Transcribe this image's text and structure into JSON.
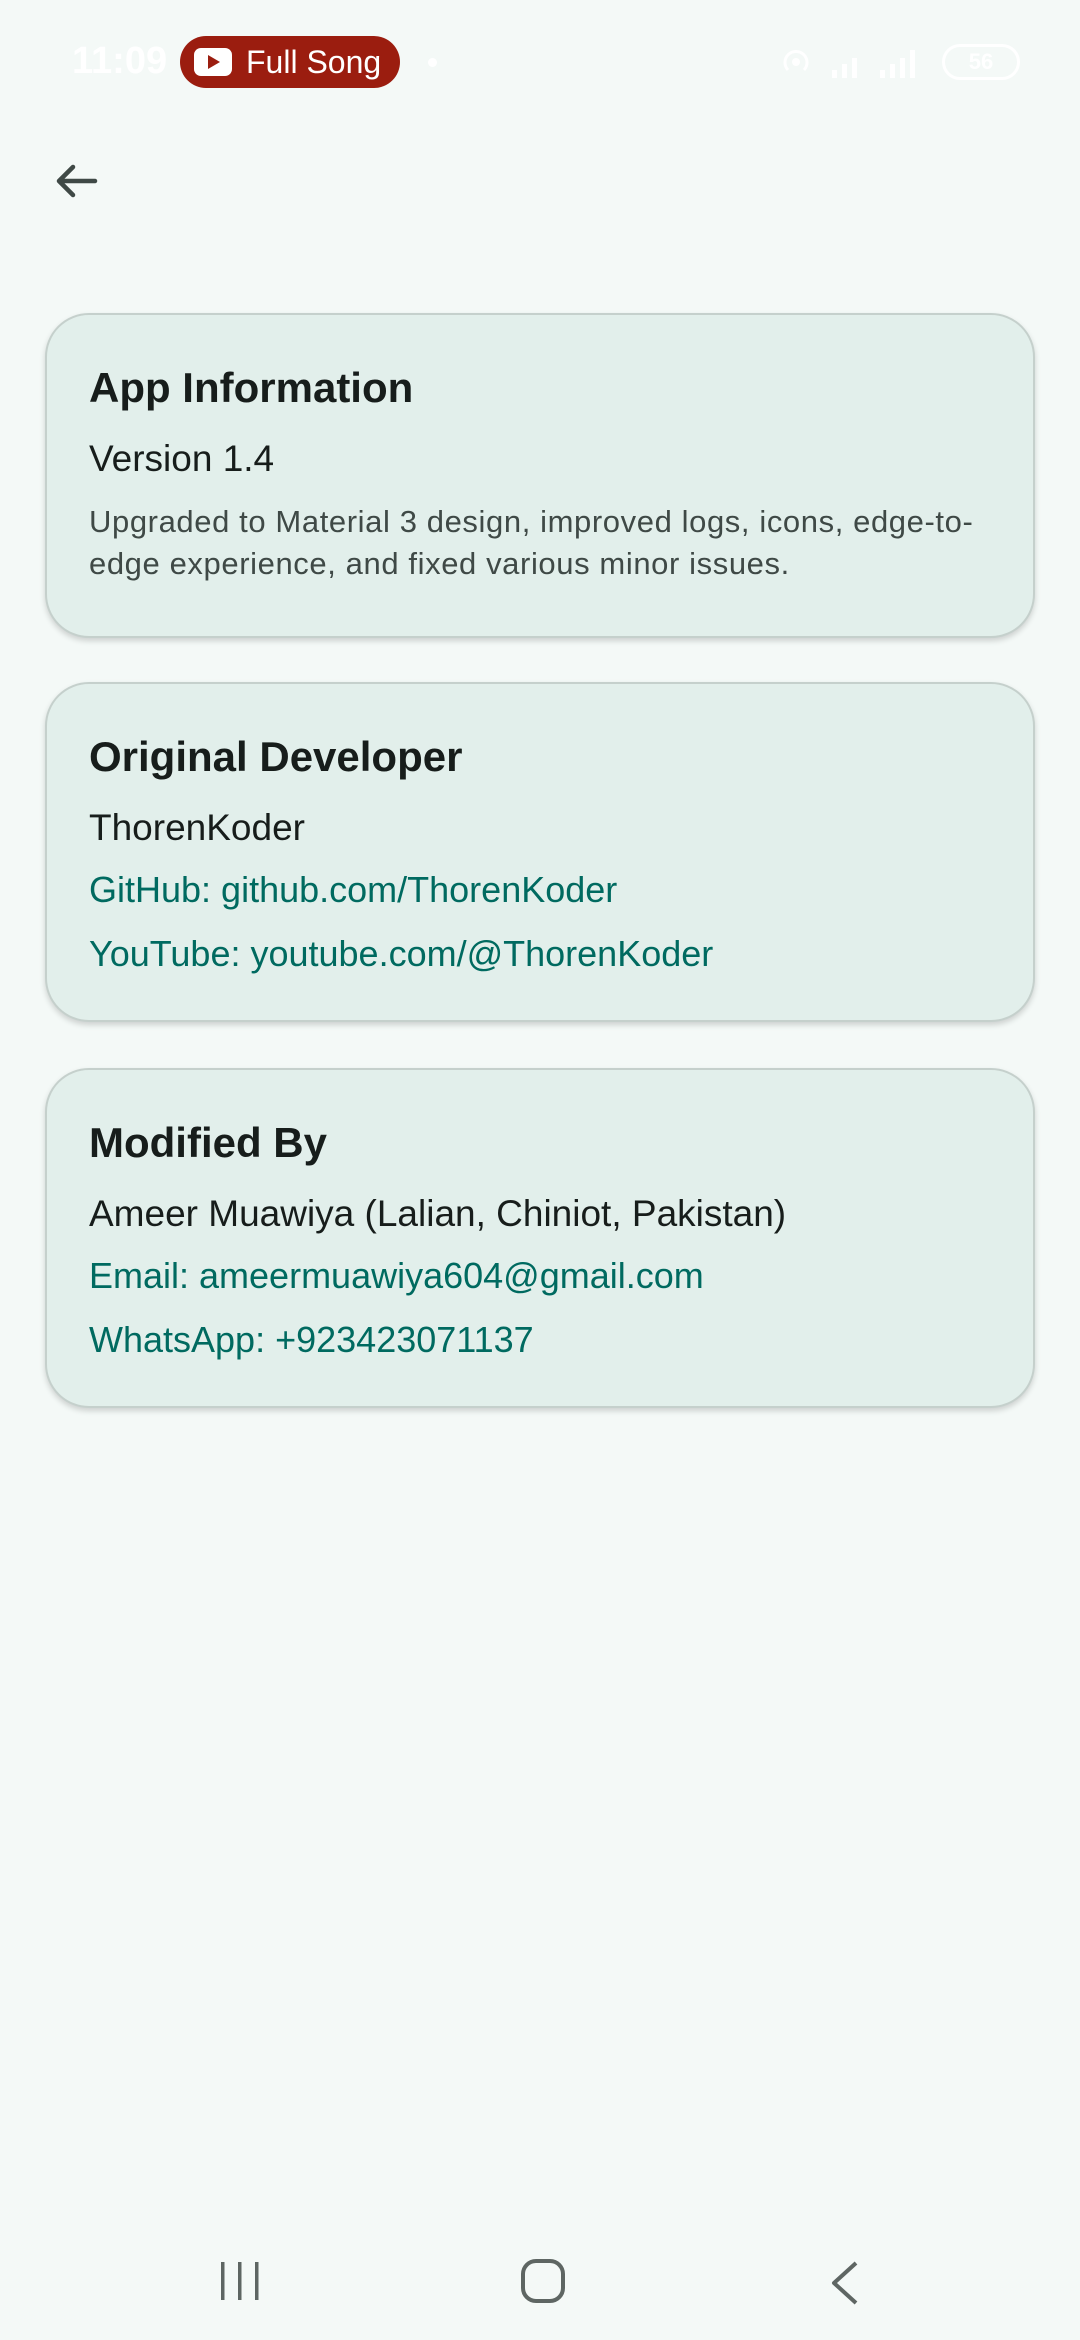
{
  "status_bar": {
    "time": "11:09",
    "media_pill": {
      "label": "Full Song",
      "icon": "youtube-icon",
      "color": "#9b1d0f"
    },
    "battery": "56"
  },
  "toolbar": {
    "back_icon": "arrow-back-icon"
  },
  "cards": [
    {
      "title": "App Information",
      "primary": "Version 1.4",
      "description": "Upgraded to Material 3 design, improved logs, icons, edge-to-edge experience, and fixed various minor issues."
    },
    {
      "title": "Original Developer",
      "primary": "ThorenKoder",
      "links": [
        "GitHub: github.com/ThorenKoder",
        "YouTube: youtube.com/@ThorenKoder"
      ]
    },
    {
      "title": "Modified By",
      "primary": "Ameer Muawiya (Lalian, Chiniot, Pakistan)",
      "links": [
        "Email: ameermuawiya604@gmail.com",
        "WhatsApp: +923423071137"
      ]
    }
  ],
  "colors": {
    "background": "#f4f9f7",
    "card": "#e2efeb",
    "link": "#006a60",
    "text": "#171d1b"
  },
  "nav_bar": {
    "icons": [
      "recents-icon",
      "home-icon",
      "back-icon"
    ]
  }
}
